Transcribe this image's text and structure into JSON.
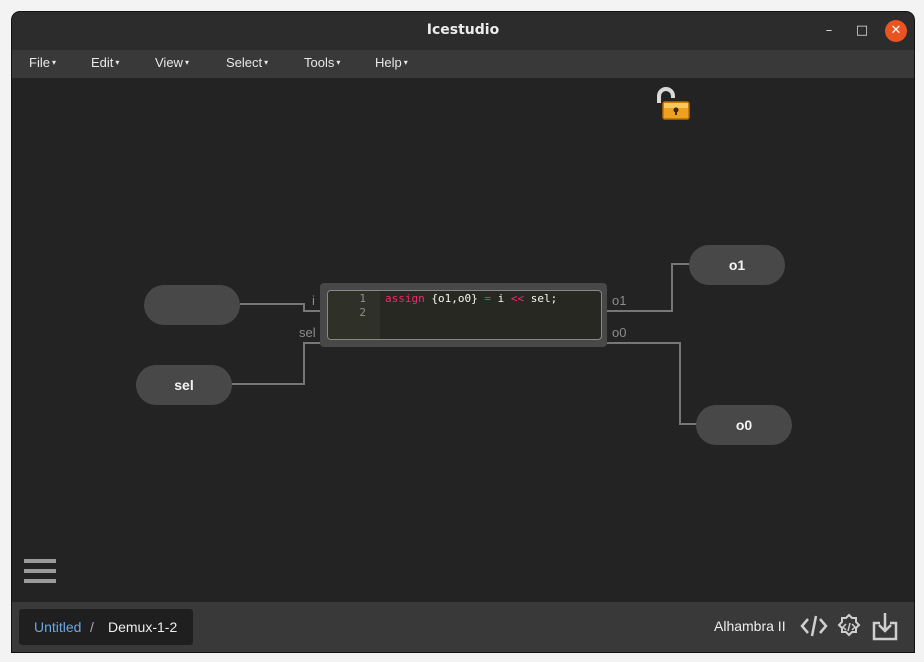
{
  "window": {
    "title": "Icestudio",
    "min_glyph": "–",
    "max_glyph": "□",
    "close_glyph": "✕"
  },
  "menu": {
    "items": [
      {
        "label": "File"
      },
      {
        "label": "Edit"
      },
      {
        "label": "View"
      },
      {
        "label": "Select"
      },
      {
        "label": "Tools"
      },
      {
        "label": "Help"
      }
    ],
    "caret": "▾"
  },
  "canvas": {
    "lock_icon": "unlocked-padlock-icon",
    "inputs": [
      {
        "label": ""
      },
      {
        "label": "sel"
      }
    ],
    "outputs": [
      {
        "label": "o1"
      },
      {
        "label": "o0"
      }
    ],
    "code_block": {
      "ports_in": [
        "i",
        "sel"
      ],
      "ports_out": [
        "o1",
        "o0"
      ],
      "line_numbers": [
        "1",
        "2"
      ],
      "code": {
        "kw_assign": "assign",
        "part1": " {o1,o0} ",
        "op_eq": "=",
        "part2": " i ",
        "op_shift": "<<",
        "part3": " sel;"
      }
    }
  },
  "statusbar": {
    "breadcrumb_project": "Untitled",
    "breadcrumb_sep": "/",
    "breadcrumb_file": "Demux-1-2",
    "board": "Alhambra II",
    "icons": [
      "code-icon",
      "gear-code-icon",
      "download-icon"
    ]
  },
  "colors": {
    "accent": "#e95420",
    "link": "#6aa8e0",
    "keyword": "#f92672"
  }
}
